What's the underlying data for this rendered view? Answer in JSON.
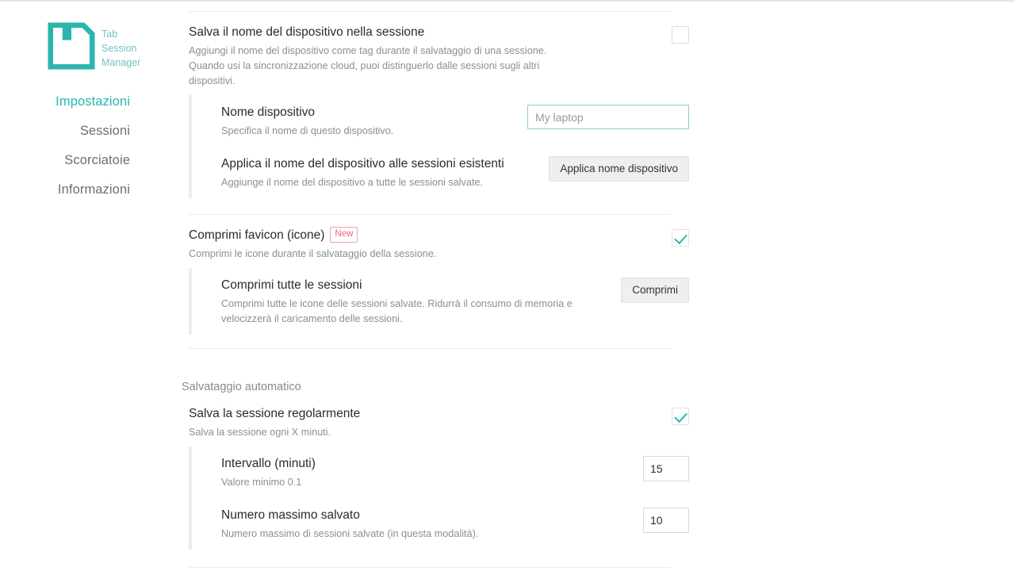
{
  "brand": {
    "icon": "floppy-disk-icon",
    "line1": "Tab",
    "line2": "Session",
    "line3": "Manager",
    "accent_color": "#6fc3c6"
  },
  "sidebar": {
    "items": [
      {
        "label": "Impostazioni",
        "active": true
      },
      {
        "label": "Sessioni",
        "active": false
      },
      {
        "label": "Scorciatoie",
        "active": false
      },
      {
        "label": "Informazioni",
        "active": false
      }
    ],
    "active_color": "#2bb5ad",
    "inactive_color": "#6e6e6e"
  },
  "settings": {
    "device_name_section": {
      "title": "Salva il nome del dispositivo nella sessione",
      "description": "Aggiungi il nome del dispositivo come tag durante il salvataggio di una sessione. Quando usi la sincronizzazione cloud, puoi distinguerlo dalle sessioni sugli altri dispositivi.",
      "checkbox_checked": false,
      "sub_rows": [
        {
          "title": "Nome dispositivo",
          "description": "Specifica il nome di questo dispositivo.",
          "control": "text-input",
          "value": "",
          "placeholder": "My laptop"
        },
        {
          "title": "Applica il nome del dispositivo alle sessioni esistenti",
          "description": "Aggiunge il nome del dispositivo a tutte le sessioni salvate.",
          "control": "button",
          "button_label": "Applica nome dispositivo"
        }
      ]
    },
    "favicon_section": {
      "title": "Comprimi favicon (icone)",
      "badge": "New",
      "badge_color": "#f0627a",
      "description": "Comprimi le icone durante il salvataggio della sessione.",
      "checkbox_checked": true,
      "sub_rows": [
        {
          "title": "Comprimi tutte le sessioni",
          "description": "Comprimi tutte le icone delle sessioni salvate. Ridurrà il consumo di memoria e velocizzerà il caricamento delle sessioni.",
          "control": "button",
          "button_label": "Comprimi"
        }
      ]
    },
    "autosave_section": {
      "group_title": "Salvataggio automatico",
      "title": "Salva la sessione regolarmente",
      "description": "Salva la sessione ogni X minuti.",
      "checkbox_checked": true,
      "sub_rows": [
        {
          "title": "Intervallo (minuti)",
          "description": "Valore minimo 0.1",
          "control": "number-input",
          "value": "15"
        },
        {
          "title": "Numero massimo salvato",
          "description": "Numero massimo di sessioni salvate (in questa modalità).",
          "control": "number-input",
          "value": "10"
        }
      ]
    }
  }
}
